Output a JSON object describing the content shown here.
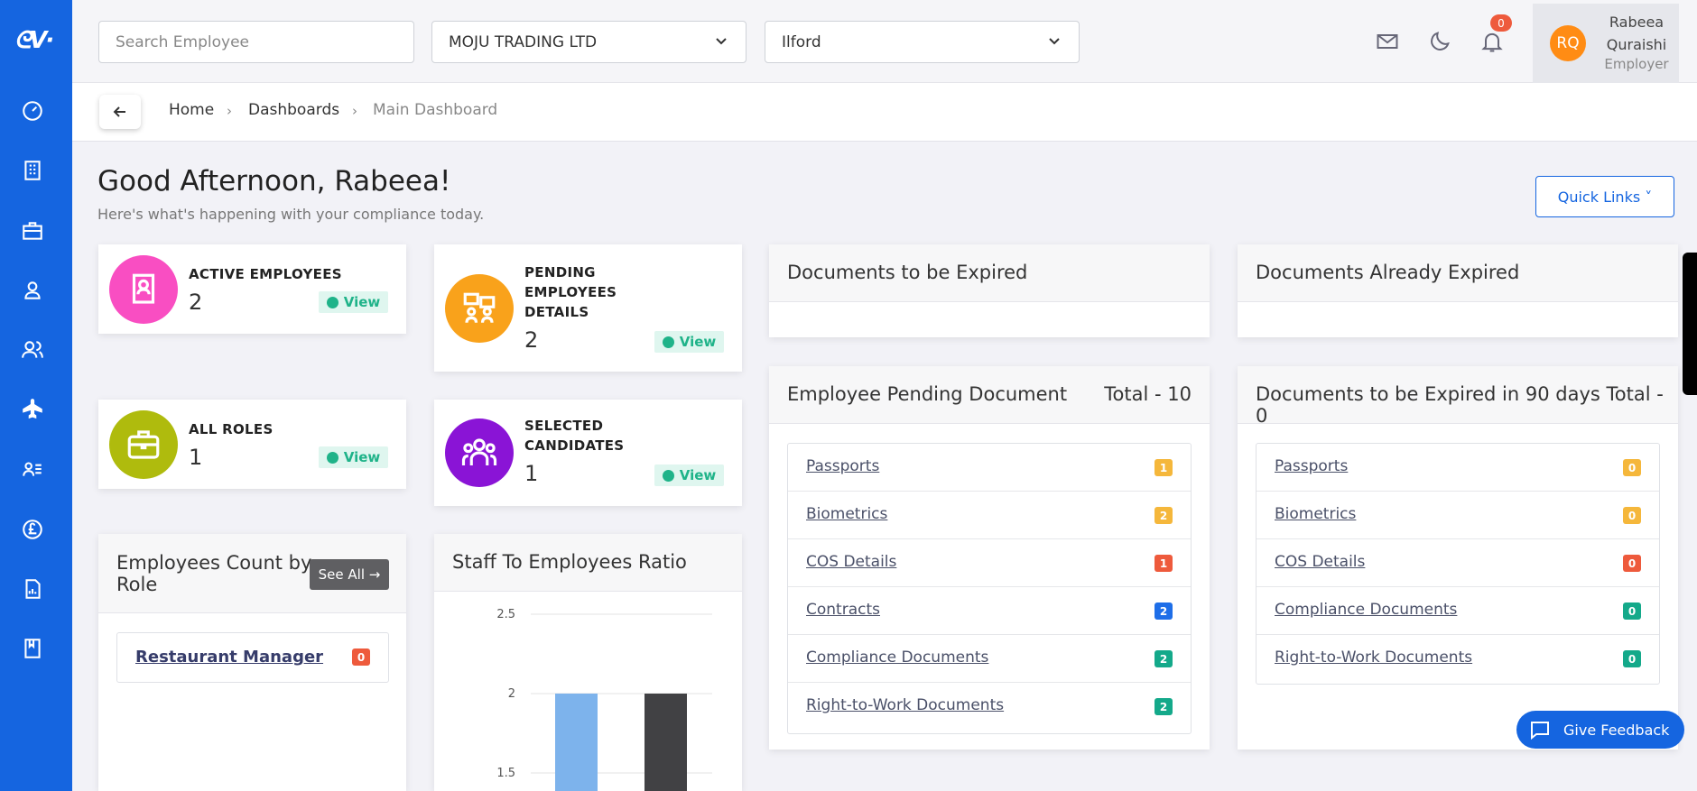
{
  "header": {
    "search_placeholder": "Search Employee",
    "company_select": "MOJU TRADING LTD",
    "location_select": "Ilford",
    "notification_count": "0",
    "user": {
      "initials": "RQ",
      "first_name": "Rabeea",
      "last_name": "Quraishi",
      "role": "Employer"
    }
  },
  "breadcrumb": {
    "home": "Home",
    "dashboards": "Dashboards",
    "current": "Main Dashboard",
    "separator": "›"
  },
  "greeting": {
    "title": "Good Afternoon, Rabeea!",
    "subtitle": "Here's what's happening with your compliance today."
  },
  "quick_links": "Quick Links  ˅",
  "stats": {
    "active_employees": {
      "title": "ACTIVE EMPLOYEES",
      "value": "2",
      "color": "#f94ec2"
    },
    "pending_details": {
      "title_lines": [
        "PENDING",
        "EMPLOYEES",
        "DETAILS"
      ],
      "value": "2",
      "color": "#f9a21b"
    },
    "all_roles": {
      "title": "ALL ROLES",
      "value": "1",
      "color": "#afbb0d"
    },
    "selected_candidates": {
      "title_lines": [
        "SELECTED",
        "CANDIDATES"
      ],
      "value": "1",
      "color": "#8a14d6"
    },
    "view_label": "View"
  },
  "documents_to_expire": {
    "title": "Documents to be Expired"
  },
  "documents_expired": {
    "title": "Documents Already Expired"
  },
  "pending_documents": {
    "title": "Employee Pending Document",
    "total": "Total - 10",
    "items": [
      {
        "label": "Passports",
        "count": "1",
        "color": "#f5b73b"
      },
      {
        "label": "Biometrics",
        "count": "2",
        "color": "#f5b73b"
      },
      {
        "label": "COS Details",
        "count": "1",
        "color": "#ee5a3c"
      },
      {
        "label": "Contracts",
        "count": "2",
        "color": "#1e6ee8"
      },
      {
        "label": "Compliance Documents",
        "count": "2",
        "color": "#14a98a"
      },
      {
        "label": "Right-to-Work Documents",
        "count": "2",
        "color": "#14a98a"
      }
    ]
  },
  "expire_90": {
    "title": "Documents to be Expired in 90 days Total - 0",
    "items": [
      {
        "label": "Passports",
        "count": "0",
        "color": "#f5b73b"
      },
      {
        "label": "Biometrics",
        "count": "0",
        "color": "#f5b73b"
      },
      {
        "label": "COS Details",
        "count": "0",
        "color": "#ee5a3c"
      },
      {
        "label": "Compliance Documents",
        "count": "0",
        "color": "#14a98a"
      },
      {
        "label": "Right-to-Work Documents",
        "count": "0",
        "color": "#14a98a"
      }
    ]
  },
  "roles_card": {
    "title_lines": [
      "Employees Count by",
      "Role"
    ],
    "see_all": "See All →",
    "role": "Restaurant Manager",
    "role_count": "0"
  },
  "ratio_card": {
    "title": "Staff To Employees Ratio"
  },
  "chart_data": {
    "type": "bar",
    "title": "Staff To Employees Ratio",
    "categories": [
      "",
      ""
    ],
    "values": [
      2,
      2
    ],
    "colors": [
      "#7db3ec",
      "#414144"
    ],
    "yticks": [
      "2.5",
      "2",
      "1.5"
    ],
    "visible_ylim": [
      1.5,
      2.5
    ]
  },
  "feedback": "Give Feedback"
}
